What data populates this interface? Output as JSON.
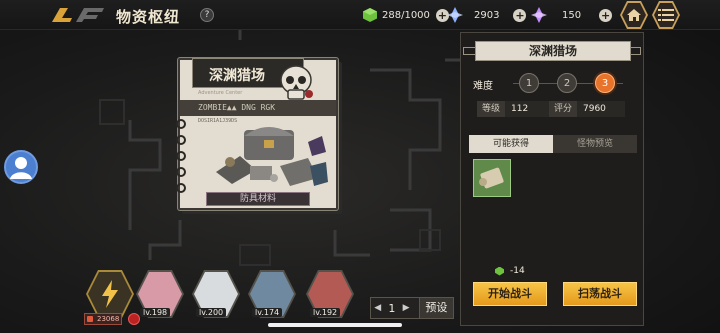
{
  "header": {
    "title": "物资枢纽",
    "help_icon": "?",
    "resources": [
      {
        "icon": "green-cube-icon",
        "value": "288/1000",
        "color": "#6ec23e"
      },
      {
        "icon": "blue-crystal-icon",
        "value": "2903",
        "color": "#8fb4ff"
      },
      {
        "icon": "purple-crystal-icon",
        "value": "150",
        "color": "#c48cff"
      }
    ],
    "plus": "+",
    "home_icon": "home-icon",
    "menu_icon": "menu-icon"
  },
  "card": {
    "title": "深渊猎场",
    "subtitle": "Adventure Center",
    "band_text": "ZOMBIE▲▲ DNG RGK",
    "code_text": "DOSIR1A1J39DS",
    "footer": "防具材料"
  },
  "team": {
    "power": "23068",
    "members": [
      {
        "level": "",
        "leader": true,
        "color": "#b08a3a"
      },
      {
        "level": "lv.198",
        "color": "#d79aa6"
      },
      {
        "level": "lv.200",
        "color": "#d9dcdf"
      },
      {
        "level": "lv.174",
        "color": "#6f8aa0"
      },
      {
        "level": "lv.192",
        "color": "#b35a55"
      }
    ]
  },
  "preset": {
    "prev": "◀",
    "number": "1",
    "next": "▶",
    "label": "预设"
  },
  "panel": {
    "title": "深渊猎场",
    "difficulty_label": "难度",
    "difficulties": [
      "1",
      "2",
      "3"
    ],
    "active_difficulty": 2,
    "stats": [
      {
        "key": "等级",
        "value": "112"
      },
      {
        "key": "评分",
        "value": "7960"
      }
    ],
    "tabs": [
      "可能获得",
      "怪物预览"
    ],
    "cost": "-14",
    "start_button": "开始战斗",
    "sweep_button": "扫荡战斗"
  },
  "colors": {
    "accent": "#e8732a",
    "button": "#f0b43a",
    "panel_bg": "#1e1d1b"
  }
}
